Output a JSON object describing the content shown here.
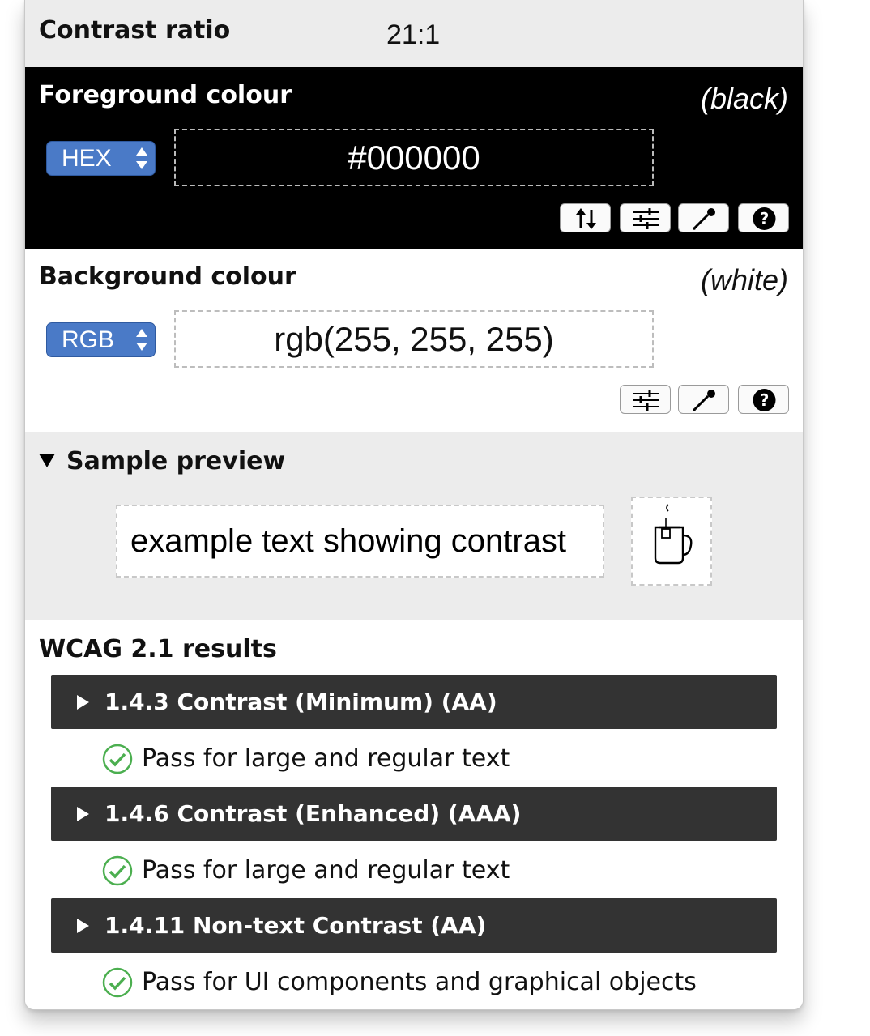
{
  "contrast": {
    "label": "Contrast ratio",
    "value": "21:1"
  },
  "foreground": {
    "title": "Foreground colour",
    "name": "(black)",
    "format": "HEX",
    "value": "#000000",
    "color": "#000000",
    "tools": [
      "swap-icon",
      "sliders-icon",
      "eyedropper-icon",
      "help-icon"
    ]
  },
  "background": {
    "title": "Background colour",
    "name": "(white)",
    "format": "RGB",
    "value": "rgb(255, 255, 255)",
    "color": "#ffffff",
    "tools": [
      "sliders-icon",
      "eyedropper-icon",
      "help-icon"
    ]
  },
  "preview": {
    "title": "Sample preview",
    "sample_text": "example text showing contrast",
    "icon": "tea-mug-icon"
  },
  "results": {
    "title": "WCAG 2.1 results",
    "criteria": [
      {
        "label": "1.4.3 Contrast (Minimum) (AA)",
        "result": "Pass for large and regular text"
      },
      {
        "label": "1.4.6 Contrast (Enhanced) (AAA)",
        "result": "Pass for large and regular text"
      },
      {
        "label": "1.4.11 Non-text Contrast (AA)",
        "result": "Pass for UI components and graphical objects"
      }
    ]
  },
  "colors": {
    "accent": "#4a7ac7",
    "pass": "#4caf50",
    "criterion_bg": "#333333",
    "section_bg": "#ececec"
  }
}
